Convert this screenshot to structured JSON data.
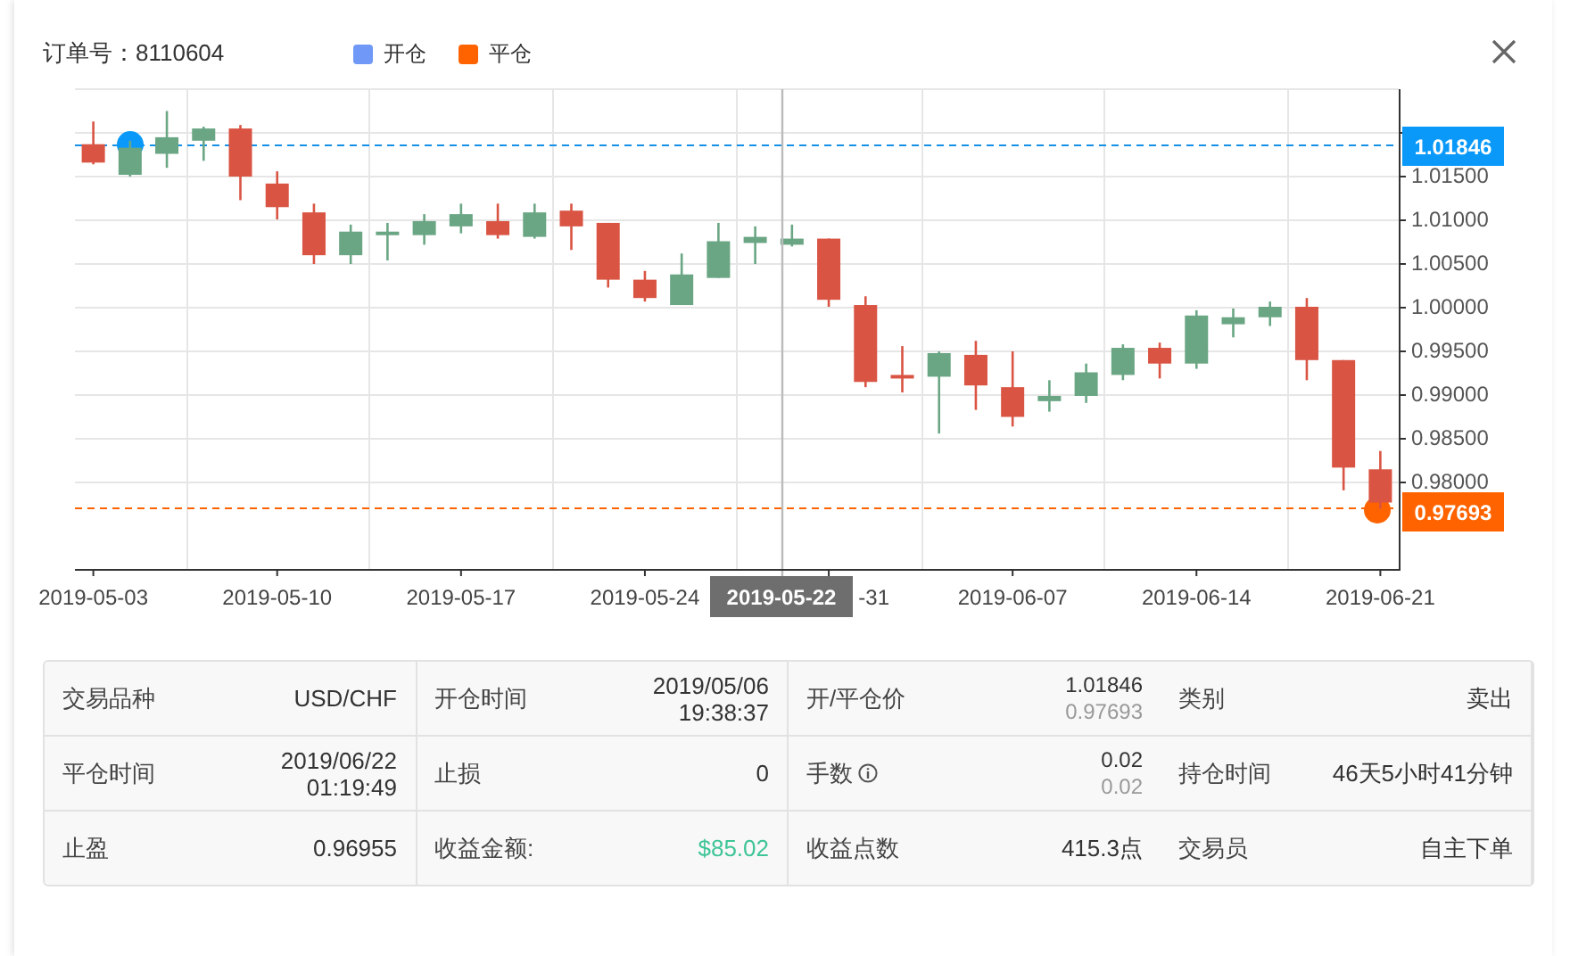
{
  "order_title": "订单号：8110604",
  "legend": [
    {
      "label": "开仓",
      "color": "#6f98f7"
    },
    {
      "label": "平仓",
      "color": "#ff6300"
    }
  ],
  "chart": {
    "open_price": "1.01846",
    "close_price": "0.97693",
    "crosshair_date": "2019-05-22",
    "covered_tick_label": "-31",
    "chart_data": {
      "type": "candlestick",
      "ylim": [
        0.97,
        1.025
      ],
      "grid": true,
      "ref_lines": [
        {
          "axis": "y",
          "value": 1.01846,
          "color": "#1590e6"
        },
        {
          "axis": "y",
          "value": 0.97693,
          "color": "#ff6300"
        }
      ],
      "categories": [
        "2019-05-03",
        null,
        null,
        null,
        null,
        "2019-05-10",
        null,
        null,
        null,
        null,
        "2019-05-17",
        null,
        null,
        null,
        null,
        "2019-05-24",
        null,
        null,
        null,
        null,
        null,
        null,
        null,
        null,
        null,
        "2019-06-07",
        null,
        null,
        null,
        null,
        "2019-06-14",
        null,
        null,
        null,
        null,
        "2019-06-21"
      ],
      "ohlc": [
        [
          1.0186,
          1.0212,
          1.0163,
          1.0165
        ],
        [
          1.0151,
          1.019,
          1.0149,
          1.0182
        ],
        [
          1.0175,
          1.0224,
          1.0159,
          1.0194
        ],
        [
          1.019,
          1.0206,
          1.0167,
          1.0204
        ],
        [
          1.0204,
          1.0208,
          1.0122,
          1.0149
        ],
        [
          1.0141,
          1.0155,
          1.01,
          1.0114
        ],
        [
          1.0108,
          1.0118,
          1.0049,
          1.0059
        ],
        [
          1.0059,
          1.0094,
          1.0049,
          1.0086
        ],
        [
          1.0082,
          1.0096,
          1.0053,
          1.0086
        ],
        [
          1.0082,
          1.0106,
          1.0071,
          1.0098
        ],
        [
          1.0092,
          1.0118,
          1.0084,
          1.0106
        ],
        [
          1.0098,
          1.0118,
          1.0078,
          1.0082
        ],
        [
          1.008,
          1.0118,
          1.0078,
          1.0108
        ],
        [
          1.011,
          1.0118,
          1.0065,
          1.0092
        ],
        [
          1.0096,
          1.0096,
          1.0022,
          1.0031
        ],
        [
          1.0031,
          1.0041,
          1.0006,
          1.001
        ],
        [
          1.0002,
          1.0061,
          1.0002,
          1.0037
        ],
        [
          1.0033,
          1.0096,
          1.0033,
          1.0075
        ],
        [
          1.0073,
          1.0092,
          1.0049,
          1.008
        ],
        [
          1.0071,
          1.0094,
          1.0069,
          1.0078
        ],
        [
          1.0078,
          1.0078,
          1.0,
          1.0008
        ],
        [
          1.0002,
          1.0012,
          0.9908,
          0.9914
        ],
        [
          0.9922,
          0.9955,
          0.9902,
          0.9918
        ],
        [
          0.992,
          0.9949,
          0.9855,
          0.9947
        ],
        [
          0.9945,
          0.9961,
          0.9882,
          0.991
        ],
        [
          0.9908,
          0.9949,
          0.9863,
          0.9874
        ],
        [
          0.9892,
          0.9916,
          0.988,
          0.9898
        ],
        [
          0.9898,
          0.9935,
          0.989,
          0.9925
        ],
        [
          0.9922,
          0.9957,
          0.9916,
          0.9953
        ],
        [
          0.9953,
          0.9959,
          0.9918,
          0.9935
        ],
        [
          0.9935,
          0.9996,
          0.9929,
          0.999
        ],
        [
          0.998,
          0.9998,
          0.9965,
          0.9988
        ],
        [
          0.9988,
          1.0006,
          0.9978,
          1.0
        ],
        [
          1.0,
          1.001,
          0.9916,
          0.9939
        ],
        [
          0.9939,
          0.9939,
          0.979,
          0.9816
        ],
        [
          0.9814,
          0.9835,
          0.9769,
          0.9776
        ]
      ],
      "yticks": [
        {
          "value": 1.015,
          "label": "1.01500"
        },
        {
          "value": 1.01,
          "label": "1.01000"
        },
        {
          "value": 1.005,
          "label": "1.00500"
        },
        {
          "value": 1.0,
          "label": "1.00000"
        },
        {
          "value": 0.995,
          "label": "0.99500"
        },
        {
          "value": 0.99,
          "label": "0.99000"
        },
        {
          "value": 0.985,
          "label": "0.98500"
        },
        {
          "value": 0.98,
          "label": "0.98000"
        }
      ]
    }
  },
  "details": [
    {
      "label": "交易品种",
      "kind": "text",
      "info": false,
      "values": [
        "USD/CHF"
      ]
    },
    {
      "label": "开仓时间",
      "kind": "datetime",
      "info": false,
      "values": [
        "2019/05/06",
        "19:38:37"
      ]
    },
    {
      "label": "开/平仓价",
      "kind": "dual",
      "info": false,
      "values": [
        "1.01846",
        "0.97693"
      ]
    },
    {
      "label": "类别",
      "kind": "text",
      "info": false,
      "values": [
        "卖出"
      ]
    },
    {
      "label": "平仓时间",
      "kind": "datetime",
      "info": false,
      "values": [
        "2019/06/22",
        "01:19:49"
      ]
    },
    {
      "label": "止损",
      "kind": "text",
      "info": false,
      "values": [
        "0"
      ]
    },
    {
      "label": "手数",
      "kind": "dual",
      "info": true,
      "values": [
        "0.02",
        "0.02"
      ]
    },
    {
      "label": "持仓时间",
      "kind": "text",
      "info": false,
      "values": [
        "46天5小时41分钟"
      ]
    },
    {
      "label": "止盈",
      "kind": "text",
      "info": false,
      "values": [
        "0.96955"
      ]
    },
    {
      "label": "收益金额:",
      "kind": "profit",
      "info": false,
      "values": [
        "$85.02"
      ]
    },
    {
      "label": "收益点数",
      "kind": "text",
      "info": false,
      "values": [
        "415.3点"
      ]
    },
    {
      "label": "交易员",
      "kind": "text",
      "info": false,
      "values": [
        "自主下单"
      ]
    }
  ]
}
